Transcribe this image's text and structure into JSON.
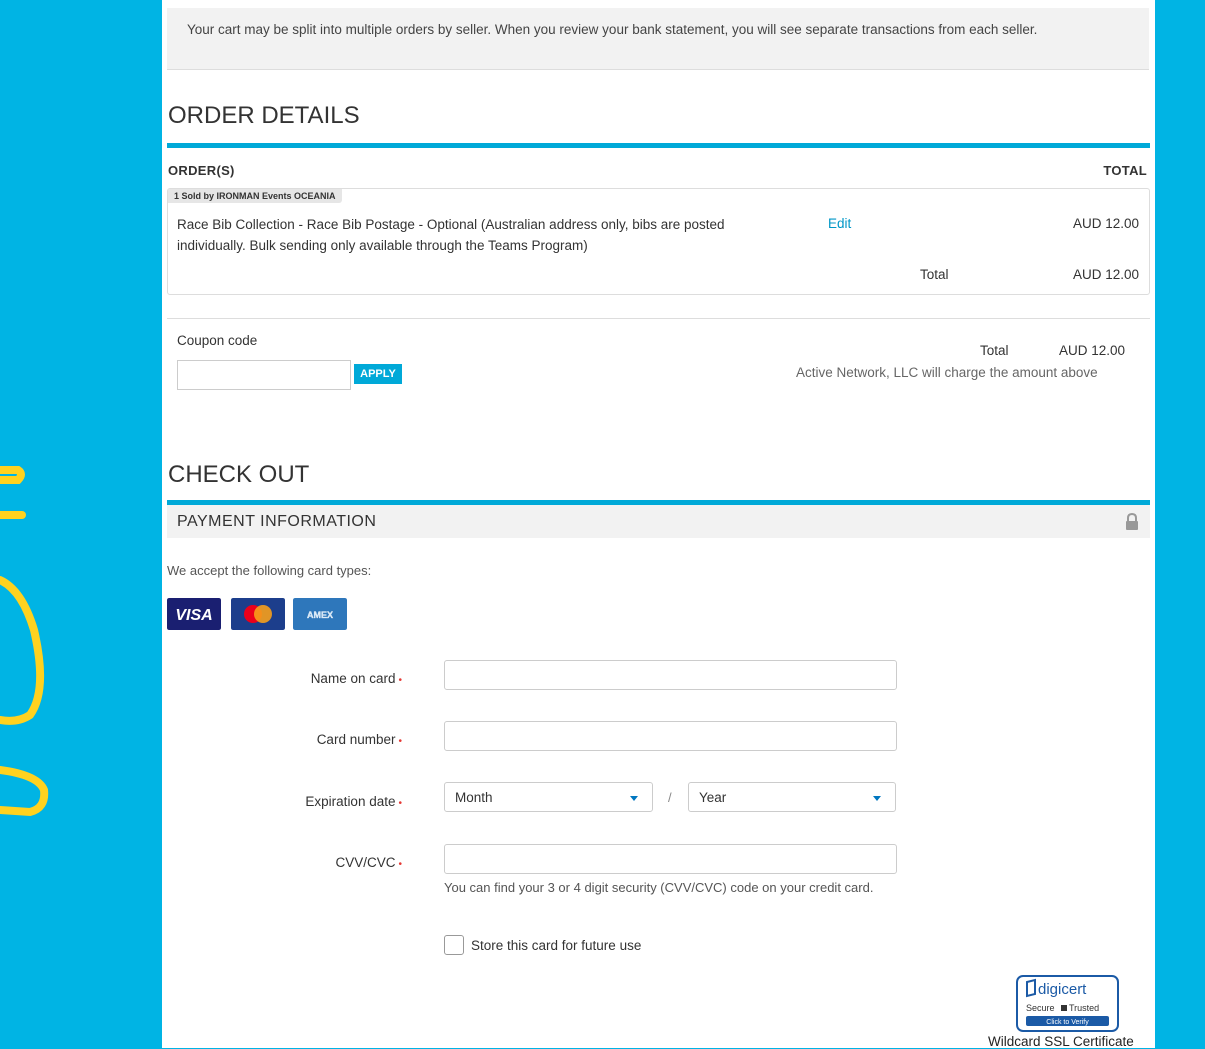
{
  "notice": {
    "text": "Your cart may be split into multiple orders by seller. When you review your bank statement, you will see separate transactions from each seller."
  },
  "order_details": {
    "title": "ORDER DETAILS",
    "col_orders": "ORDER(S)",
    "col_total": "TOTAL",
    "seller_tag": "1 Sold by IRONMAN Events OCEANIA",
    "item": {
      "description": "Race Bib Collection - Race Bib Postage - Optional (Australian address only, bibs are posted individually. Bulk sending only available through the Teams Program)",
      "edit_label": "Edit",
      "price": "AUD 12.00"
    },
    "subtotal_label": "Total",
    "subtotal_value": "AUD 12.00"
  },
  "coupon": {
    "label": "Coupon code",
    "input_value": "",
    "apply_label": "APPLY"
  },
  "summary": {
    "total_label": "Total",
    "total_value": "AUD 12.00",
    "charge_note": "Active Network, LLC will charge the amount above"
  },
  "checkout": {
    "title": "CHECK OUT",
    "payment_title": "PAYMENT INFORMATION",
    "accept_text": "We accept the following card types:",
    "cards": [
      {
        "name": "VISA",
        "label": "VISA",
        "color": "#1a1f71"
      },
      {
        "name": "MasterCard",
        "label": "MasterCard",
        "color": "#1c3e8c"
      },
      {
        "name": "AMEX",
        "label": "AMEX",
        "color": "#2e77bb"
      }
    ],
    "fields": {
      "name_label": "Name on card",
      "card_number_label": "Card number",
      "expiration_label": "Expiration date",
      "month_value": "Month",
      "separator": "/",
      "year_value": "Year",
      "cvv_label": "CVV/CVC",
      "cvv_help": "You can find your 3 or 4 digit security (CVV/CVC) code on your credit card.",
      "required_mark": "•",
      "store_label": "Store this card for future use"
    }
  },
  "badge": {
    "brand": "digicert",
    "line1": "Secure",
    "line1b": "Trusted",
    "line2": "Click to Verify",
    "caption": "Wildcard SSL Certificate"
  },
  "colors": {
    "page_background": "#00b4e4",
    "accent": "#00a9d8",
    "link": "#0097c7",
    "required": "#e53935"
  }
}
